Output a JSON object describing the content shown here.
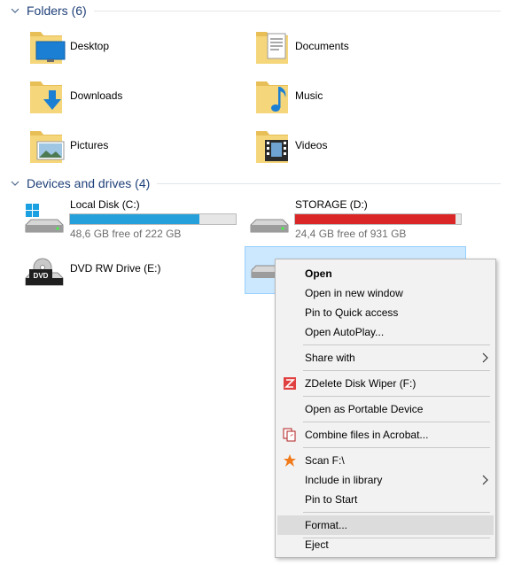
{
  "folders_section": {
    "title": "Folders (6)"
  },
  "folders": [
    {
      "name": "Desktop",
      "icon": "desktop-folder-icon"
    },
    {
      "name": "Documents",
      "icon": "documents-folder-icon"
    },
    {
      "name": "Downloads",
      "icon": "downloads-folder-icon"
    },
    {
      "name": "Music",
      "icon": "music-folder-icon"
    },
    {
      "name": "Pictures",
      "icon": "pictures-folder-icon"
    },
    {
      "name": "Videos",
      "icon": "videos-folder-icon"
    }
  ],
  "drives_section": {
    "title": "Devices and drives (4)"
  },
  "drives": [
    {
      "name": "Local Disk (C:)",
      "free_text": "48,6 GB free of 222 GB",
      "used_fraction": 0.78,
      "bar_color": "#26a0da",
      "icon": "windows-drive-icon"
    },
    {
      "name": "STORAGE (D:)",
      "free_text": "24,4 GB free of 931 GB",
      "used_fraction": 0.97,
      "bar_color": "#da2626",
      "icon": "hard-drive-icon"
    },
    {
      "name": "DVD RW Drive (E:)",
      "icon": "dvd-drive-icon"
    },
    {
      "icon": "removable-drive-icon"
    }
  ],
  "context_menu": {
    "open": "Open",
    "open_new_window": "Open in new window",
    "pin_quick_access": "Pin to Quick access",
    "open_autoplay": "Open AutoPlay...",
    "share_with": "Share with",
    "zdelete": "ZDelete Disk Wiper (F:)",
    "open_portable": "Open as Portable Device",
    "combine_acrobat": "Combine files in Acrobat...",
    "scan": "Scan F:\\",
    "include_library": "Include in library",
    "pin_start": "Pin to Start",
    "format": "Format...",
    "eject": "Eject"
  }
}
